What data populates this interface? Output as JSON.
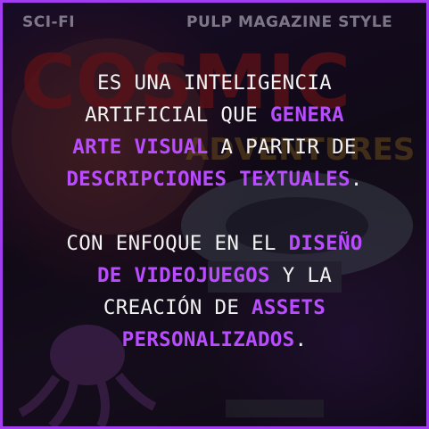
{
  "background": {
    "top_left_label": "SCI-FI",
    "top_right_label": "PULP MAGAZINE STYLE",
    "cover_title_line1": "COSMIC",
    "cover_title_line2": "ADVENTURES"
  },
  "colors": {
    "accent": "#b94cff",
    "border": "#a23cf0",
    "text": "#f2f2f2"
  },
  "paragraph1": {
    "t1": "ES UNA INTELIGENCIA",
    "t2": "ARTIFICIAL QUE ",
    "h1": "GENERA",
    "h2": "ARTE VISUAL",
    "t3": " A PARTIR DE",
    "h3": "DESCRIPCIONES TEXTUALES",
    "t4": "."
  },
  "paragraph2": {
    "t1": "CON ENFOQUE EN EL ",
    "h1": "DISEÑO",
    "h2": "DE VIDEOJUEGOS",
    "t2": " Y LA",
    "t3": "CREACIÓN DE ",
    "h3": "ASSETS",
    "h4": "PERSONALIZADOS",
    "t4": "."
  }
}
